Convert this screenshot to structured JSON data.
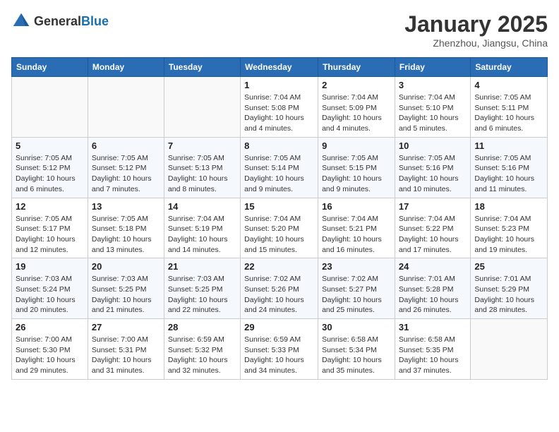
{
  "header": {
    "logo_general": "General",
    "logo_blue": "Blue",
    "month_title": "January 2025",
    "location": "Zhenzhou, Jiangsu, China"
  },
  "weekdays": [
    "Sunday",
    "Monday",
    "Tuesday",
    "Wednesday",
    "Thursday",
    "Friday",
    "Saturday"
  ],
  "weeks": [
    [
      {
        "day": "",
        "sunrise": "",
        "sunset": "",
        "daylight": ""
      },
      {
        "day": "",
        "sunrise": "",
        "sunset": "",
        "daylight": ""
      },
      {
        "day": "",
        "sunrise": "",
        "sunset": "",
        "daylight": ""
      },
      {
        "day": "1",
        "sunrise": "Sunrise: 7:04 AM",
        "sunset": "Sunset: 5:08 PM",
        "daylight": "Daylight: 10 hours and 4 minutes."
      },
      {
        "day": "2",
        "sunrise": "Sunrise: 7:04 AM",
        "sunset": "Sunset: 5:09 PM",
        "daylight": "Daylight: 10 hours and 4 minutes."
      },
      {
        "day": "3",
        "sunrise": "Sunrise: 7:04 AM",
        "sunset": "Sunset: 5:10 PM",
        "daylight": "Daylight: 10 hours and 5 minutes."
      },
      {
        "day": "4",
        "sunrise": "Sunrise: 7:05 AM",
        "sunset": "Sunset: 5:11 PM",
        "daylight": "Daylight: 10 hours and 6 minutes."
      }
    ],
    [
      {
        "day": "5",
        "sunrise": "Sunrise: 7:05 AM",
        "sunset": "Sunset: 5:12 PM",
        "daylight": "Daylight: 10 hours and 6 minutes."
      },
      {
        "day": "6",
        "sunrise": "Sunrise: 7:05 AM",
        "sunset": "Sunset: 5:12 PM",
        "daylight": "Daylight: 10 hours and 7 minutes."
      },
      {
        "day": "7",
        "sunrise": "Sunrise: 7:05 AM",
        "sunset": "Sunset: 5:13 PM",
        "daylight": "Daylight: 10 hours and 8 minutes."
      },
      {
        "day": "8",
        "sunrise": "Sunrise: 7:05 AM",
        "sunset": "Sunset: 5:14 PM",
        "daylight": "Daylight: 10 hours and 9 minutes."
      },
      {
        "day": "9",
        "sunrise": "Sunrise: 7:05 AM",
        "sunset": "Sunset: 5:15 PM",
        "daylight": "Daylight: 10 hours and 9 minutes."
      },
      {
        "day": "10",
        "sunrise": "Sunrise: 7:05 AM",
        "sunset": "Sunset: 5:16 PM",
        "daylight": "Daylight: 10 hours and 10 minutes."
      },
      {
        "day": "11",
        "sunrise": "Sunrise: 7:05 AM",
        "sunset": "Sunset: 5:16 PM",
        "daylight": "Daylight: 10 hours and 11 minutes."
      }
    ],
    [
      {
        "day": "12",
        "sunrise": "Sunrise: 7:05 AM",
        "sunset": "Sunset: 5:17 PM",
        "daylight": "Daylight: 10 hours and 12 minutes."
      },
      {
        "day": "13",
        "sunrise": "Sunrise: 7:05 AM",
        "sunset": "Sunset: 5:18 PM",
        "daylight": "Daylight: 10 hours and 13 minutes."
      },
      {
        "day": "14",
        "sunrise": "Sunrise: 7:04 AM",
        "sunset": "Sunset: 5:19 PM",
        "daylight": "Daylight: 10 hours and 14 minutes."
      },
      {
        "day": "15",
        "sunrise": "Sunrise: 7:04 AM",
        "sunset": "Sunset: 5:20 PM",
        "daylight": "Daylight: 10 hours and 15 minutes."
      },
      {
        "day": "16",
        "sunrise": "Sunrise: 7:04 AM",
        "sunset": "Sunset: 5:21 PM",
        "daylight": "Daylight: 10 hours and 16 minutes."
      },
      {
        "day": "17",
        "sunrise": "Sunrise: 7:04 AM",
        "sunset": "Sunset: 5:22 PM",
        "daylight": "Daylight: 10 hours and 17 minutes."
      },
      {
        "day": "18",
        "sunrise": "Sunrise: 7:04 AM",
        "sunset": "Sunset: 5:23 PM",
        "daylight": "Daylight: 10 hours and 19 minutes."
      }
    ],
    [
      {
        "day": "19",
        "sunrise": "Sunrise: 7:03 AM",
        "sunset": "Sunset: 5:24 PM",
        "daylight": "Daylight: 10 hours and 20 minutes."
      },
      {
        "day": "20",
        "sunrise": "Sunrise: 7:03 AM",
        "sunset": "Sunset: 5:25 PM",
        "daylight": "Daylight: 10 hours and 21 minutes."
      },
      {
        "day": "21",
        "sunrise": "Sunrise: 7:03 AM",
        "sunset": "Sunset: 5:25 PM",
        "daylight": "Daylight: 10 hours and 22 minutes."
      },
      {
        "day": "22",
        "sunrise": "Sunrise: 7:02 AM",
        "sunset": "Sunset: 5:26 PM",
        "daylight": "Daylight: 10 hours and 24 minutes."
      },
      {
        "day": "23",
        "sunrise": "Sunrise: 7:02 AM",
        "sunset": "Sunset: 5:27 PM",
        "daylight": "Daylight: 10 hours and 25 minutes."
      },
      {
        "day": "24",
        "sunrise": "Sunrise: 7:01 AM",
        "sunset": "Sunset: 5:28 PM",
        "daylight": "Daylight: 10 hours and 26 minutes."
      },
      {
        "day": "25",
        "sunrise": "Sunrise: 7:01 AM",
        "sunset": "Sunset: 5:29 PM",
        "daylight": "Daylight: 10 hours and 28 minutes."
      }
    ],
    [
      {
        "day": "26",
        "sunrise": "Sunrise: 7:00 AM",
        "sunset": "Sunset: 5:30 PM",
        "daylight": "Daylight: 10 hours and 29 minutes."
      },
      {
        "day": "27",
        "sunrise": "Sunrise: 7:00 AM",
        "sunset": "Sunset: 5:31 PM",
        "daylight": "Daylight: 10 hours and 31 minutes."
      },
      {
        "day": "28",
        "sunrise": "Sunrise: 6:59 AM",
        "sunset": "Sunset: 5:32 PM",
        "daylight": "Daylight: 10 hours and 32 minutes."
      },
      {
        "day": "29",
        "sunrise": "Sunrise: 6:59 AM",
        "sunset": "Sunset: 5:33 PM",
        "daylight": "Daylight: 10 hours and 34 minutes."
      },
      {
        "day": "30",
        "sunrise": "Sunrise: 6:58 AM",
        "sunset": "Sunset: 5:34 PM",
        "daylight": "Daylight: 10 hours and 35 minutes."
      },
      {
        "day": "31",
        "sunrise": "Sunrise: 6:58 AM",
        "sunset": "Sunset: 5:35 PM",
        "daylight": "Daylight: 10 hours and 37 minutes."
      },
      {
        "day": "",
        "sunrise": "",
        "sunset": "",
        "daylight": ""
      }
    ]
  ]
}
